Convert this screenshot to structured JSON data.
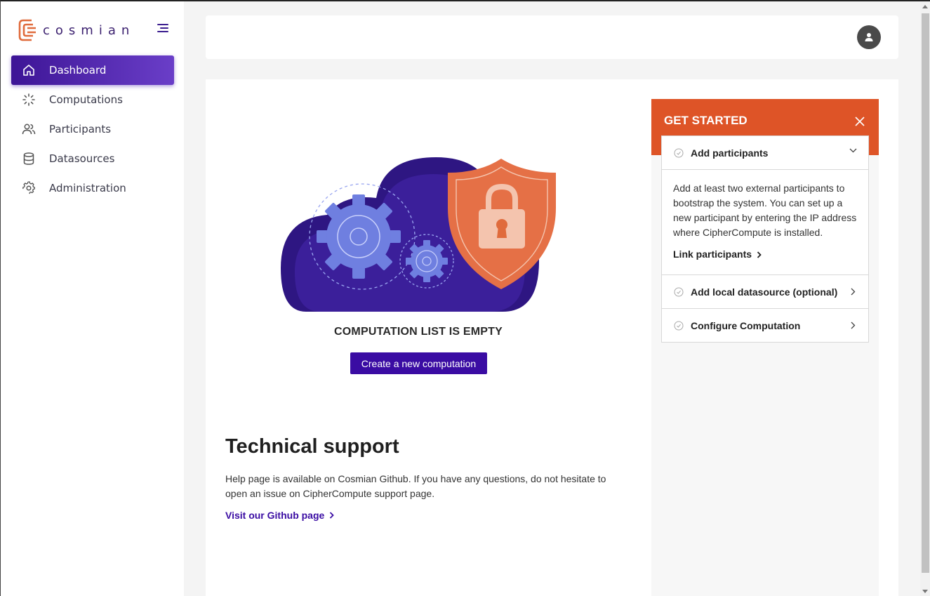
{
  "brand": {
    "name": "cosmian",
    "accent": "#e06b3c",
    "primary": "#3a0ca3"
  },
  "sidebar": {
    "items": [
      {
        "label": "Dashboard",
        "icon": "home-icon",
        "active": true
      },
      {
        "label": "Computations",
        "icon": "spinner-icon",
        "active": false
      },
      {
        "label": "Participants",
        "icon": "users-icon",
        "active": false
      },
      {
        "label": "Datasources",
        "icon": "database-icon",
        "active": false
      },
      {
        "label": "Administration",
        "icon": "gear-icon",
        "active": false
      }
    ]
  },
  "header": {
    "avatar_icon": "user-icon"
  },
  "main": {
    "empty_title": "COMPUTATION LIST IS EMPTY",
    "create_button": "Create a new computation",
    "support": {
      "title": "Technical support",
      "text": "Help page is available on Cosmian Github. If you have any questions, do not hesitate to open an issue on CipherCompute support page.",
      "link": "Visit our Github page"
    }
  },
  "get_started": {
    "title": "GET STARTED",
    "header_color": "#de5427",
    "steps": [
      {
        "title": "Add participants",
        "expanded": true,
        "body": "Add at least two external participants to bootstrap the system. You can set up a new participant by entering the IP address where CipherCompute is installed.",
        "link": "Link participants"
      },
      {
        "title": "Add local datasource (optional)",
        "expanded": false
      },
      {
        "title": "Configure Computation",
        "expanded": false
      }
    ]
  }
}
